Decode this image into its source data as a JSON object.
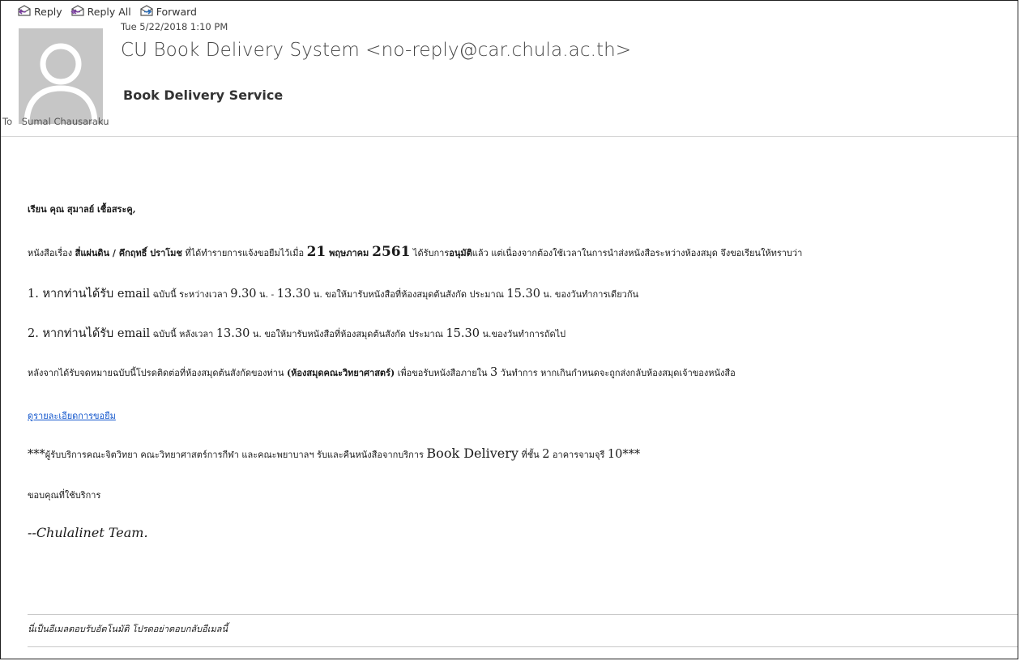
{
  "toolbar": {
    "reply_label": "Reply",
    "reply_all_label": "Reply All",
    "forward_label": "Forward"
  },
  "header": {
    "date": "Tue 5/22/2018 1:10 PM",
    "sender": "CU Book Delivery System <no-reply@car.chula.ac.th>",
    "subject": "Book Delivery Service",
    "to_label": "To",
    "recipient": "Sumal Chausaraku"
  },
  "body": {
    "greeting": "เรียน คุณ สุมาลย์ เชื้อสระคู,",
    "p1": {
      "a": "หนังสือเรื่อง ",
      "book_title": "สี่แผ่นดิน / คึกฤทธิ์ ปราโมช",
      "b": " ที่ได้ทำรายการแจ้งขอยืมไว้เมื่อ ",
      "day": "21",
      "month": " พฤษภาคม ",
      "year": "2561",
      "c": " ได้รับการ",
      "approved": "อนุมัติ",
      "d": "แล้ว แต่เนื่องจากต้องใช้เวลาในการนำส่งหนังสือระหว่างห้องสมุด จึงขอเรียนให้ทราบว่า"
    },
    "item1": {
      "a": "1. หากท่านได้รับ ",
      "email": "email",
      "b": " ฉบับนี้ ระหว่างเวลา ",
      "t1": "9.30",
      "c": " น. - ",
      "t2": "13.30",
      "d": " น. ขอให้มารับหนังสือที่ห้องสมุดต้นสังกัด ประมาณ ",
      "t3": "15.30",
      "e": " น. ของวันทำการเดียวกัน"
    },
    "item2": {
      "a": "2. หากท่านได้รับ ",
      "email": "email",
      "b": " ฉบับนี้ หลังเวลา ",
      "t1": "13.30",
      "c": " น. ขอให้มารับหนังสือที่ห้องสมุดต้นสังกัด ประมาณ ",
      "t2": "15.30",
      "d": " น.ของวันทำการถัดไป"
    },
    "p3": {
      "a": "หลังจากได้รับจดหมายฉบับนี้โปรดติดต่อที่ห้องสมุดต้นสังกัดของท่าน ",
      "library": "(ห้องสมุดคณะวิทยาศาสตร์)",
      "b": " เพื่อขอรับหนังสือภายใน ",
      "days": "3",
      "c": " วันทำการ หากเกินกำหนดจะถูกส่งกลับห้องสมุดเจ้าของหนังสือ"
    },
    "link_text": "ดูรายละเอียดการขอยืม",
    "note": {
      "a": "***",
      "b": "ผู้รับบริการคณะจิตวิทยา คณะวิทยาศาสตร์การกีฬา และคณะพยาบาลฯ รับและคืนหนังสือจากบริการ ",
      "service": "Book Delivery",
      "c": " ที่ชั้น ",
      "floor": "2",
      "d": " อาคารจามจุรี ",
      "building": "10***"
    },
    "thanks": "ขอบคุณที่ใช้บริการ",
    "signature": "--Chulalinet Team."
  },
  "footer": {
    "text": "นี่เป็นอีเมลตอบรับอัตโนมัติ โปรดอย่าตอบกลับอีเมลนี้"
  }
}
